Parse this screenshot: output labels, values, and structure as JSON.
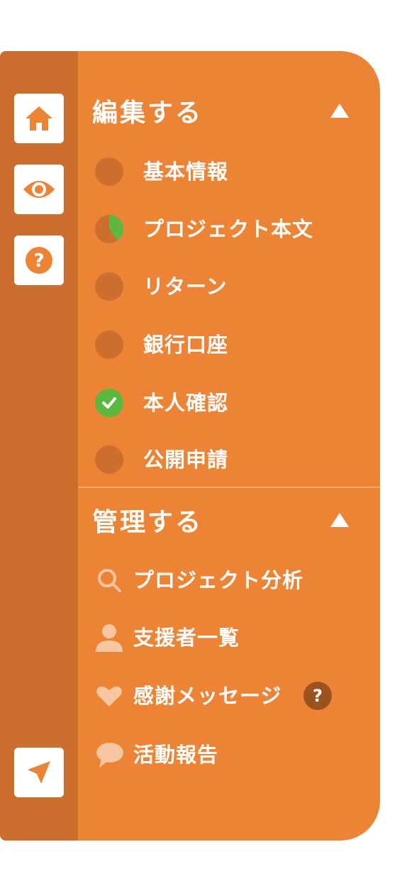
{
  "rail": {
    "home_icon": "home-icon",
    "preview_icon": "eye-icon",
    "help_icon": "question-icon",
    "send_icon": "paper-plane-icon"
  },
  "edit_section": {
    "title": "編集する",
    "expanded": true,
    "steps": [
      {
        "label": "基本情報",
        "status": "incomplete"
      },
      {
        "label": "プロジェクト本文",
        "status": "partial",
        "progress": 0.4
      },
      {
        "label": "リターン",
        "status": "incomplete"
      },
      {
        "label": "銀行口座",
        "status": "incomplete"
      },
      {
        "label": "本人確認",
        "status": "complete"
      },
      {
        "label": "公開申請",
        "status": "incomplete"
      }
    ]
  },
  "manage_section": {
    "title": "管理する",
    "expanded": true,
    "items": [
      {
        "label": "プロジェクト分析",
        "icon": "search-icon"
      },
      {
        "label": "支援者一覧",
        "icon": "user-icon"
      },
      {
        "label": "感謝メッセージ",
        "icon": "heart-icon",
        "help": "?"
      },
      {
        "label": "活動報告",
        "icon": "speech-bubble-icon"
      }
    ]
  },
  "colors": {
    "panel": "#ED8335",
    "rail": "#CB6E2E",
    "dot_incomplete": "#CB6E2E",
    "complete": "#5DB83F",
    "icon_light": "#F8C6A0"
  }
}
